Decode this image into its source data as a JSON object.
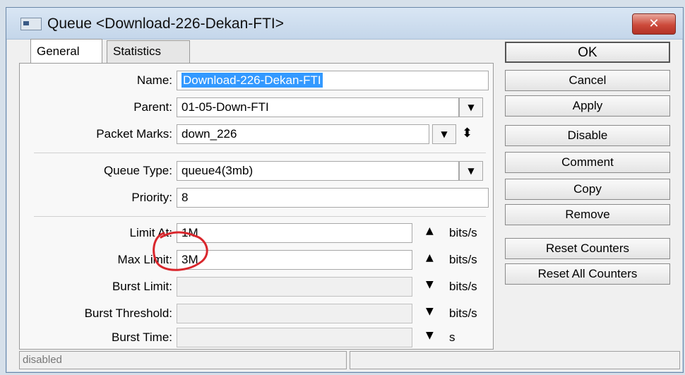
{
  "window": {
    "title": "Queue <Download-226-Dekan-FTI>",
    "close_glyph": "✕"
  },
  "tabs": [
    {
      "label": "General",
      "active": true
    },
    {
      "label": "Statistics",
      "active": false
    }
  ],
  "fields": {
    "name": {
      "label": "Name:",
      "value": "Download-226-Dekan-FTI"
    },
    "parent": {
      "label": "Parent:",
      "value": "01-05-Down-FTI"
    },
    "packet_marks": {
      "label": "Packet Marks:",
      "value": "down_226"
    },
    "queue_type": {
      "label": "Queue Type:",
      "value": "queue4(3mb)"
    },
    "priority": {
      "label": "Priority:",
      "value": "8"
    },
    "limit_at": {
      "label": "Limit At:",
      "value": "1M",
      "unit": "bits/s"
    },
    "max_limit": {
      "label": "Max Limit:",
      "value": "3M",
      "unit": "bits/s"
    },
    "burst_limit": {
      "label": "Burst Limit:",
      "value": "",
      "unit": "bits/s"
    },
    "burst_threshold": {
      "label": "Burst Threshold:",
      "value": "",
      "unit": "bits/s"
    },
    "burst_time": {
      "label": "Burst Time:",
      "value": "",
      "unit": "s"
    }
  },
  "glyphs": {
    "dropdown": "▼",
    "updown": "⬍",
    "up": "▲",
    "down": "▼"
  },
  "buttons": {
    "ok": "OK",
    "cancel": "Cancel",
    "apply": "Apply",
    "disable": "Disable",
    "comment": "Comment",
    "copy": "Copy",
    "remove": "Remove",
    "reset_counters": "Reset Counters",
    "reset_all_counters": "Reset All Counters"
  },
  "status": {
    "left": "disabled",
    "right": ""
  },
  "colors": {
    "annotation": "#d9262c",
    "selection": "#3399ff",
    "close_button": "#cc4a3b"
  }
}
